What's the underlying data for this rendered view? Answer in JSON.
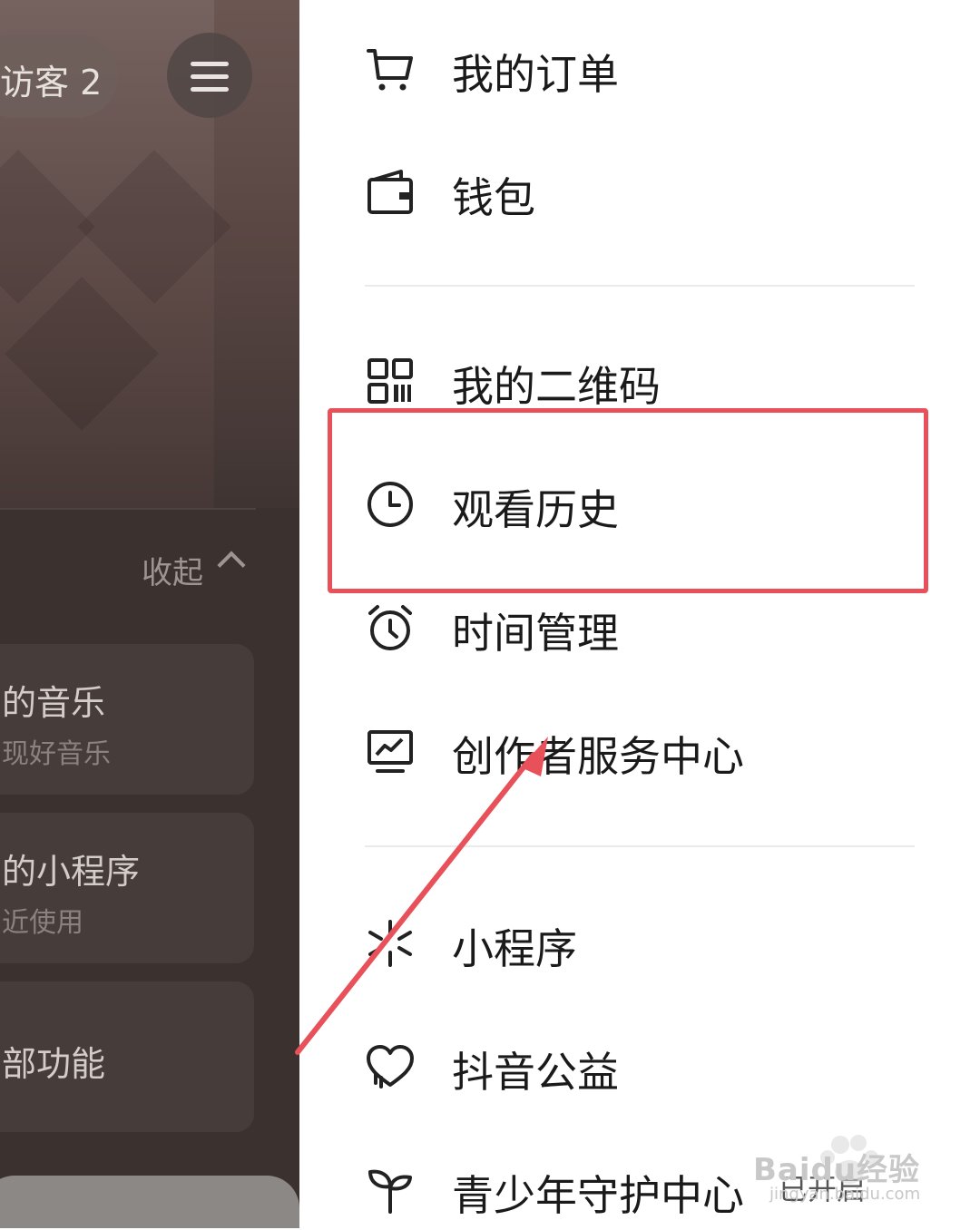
{
  "left_panel": {
    "visitor_text": "访客 2",
    "collapse_label": "收起",
    "cards": [
      {
        "title": "的音乐",
        "subtitle": "现好音乐"
      },
      {
        "title": "的小程序",
        "subtitle": "近使用"
      },
      {
        "title": "部功能",
        "subtitle": ""
      }
    ]
  },
  "menu": {
    "items": [
      {
        "label": "我的订单",
        "icon": "cart-icon"
      },
      {
        "label": "钱包",
        "icon": "wallet-icon"
      },
      {
        "label": "我的二维码",
        "icon": "qrcode-icon"
      },
      {
        "label": "观看历史",
        "icon": "clock-icon"
      },
      {
        "label": "时间管理",
        "icon": "alarm-icon"
      },
      {
        "label": "创作者服务中心",
        "icon": "monitor-chart-icon"
      },
      {
        "label": "小程序",
        "icon": "miniprogram-icon"
      },
      {
        "label": "抖音公益",
        "icon": "heart-icon"
      },
      {
        "label": "青少年守护中心",
        "icon": "sprout-icon"
      }
    ],
    "youth_status": "已开启"
  },
  "annotation": {
    "color": "#e8515a"
  },
  "watermark": {
    "text": "Baidu经验",
    "sub": "jingyan.baidu.com"
  }
}
